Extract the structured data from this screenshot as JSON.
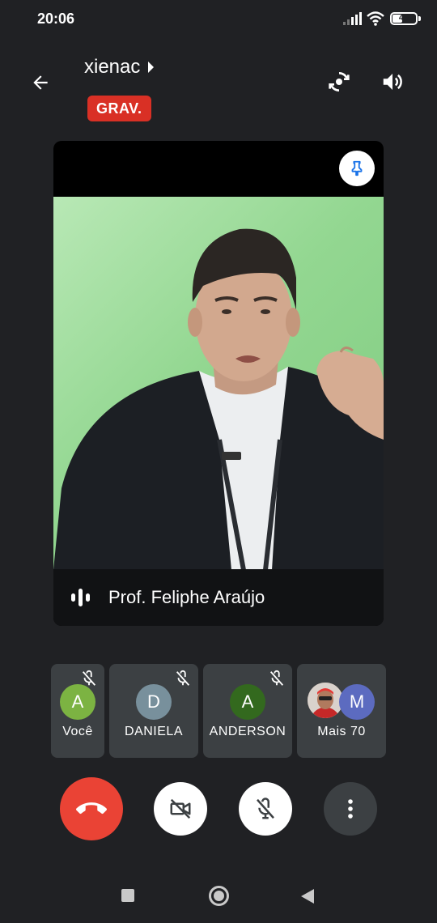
{
  "status_bar": {
    "time": "20:06",
    "battery_level": "43",
    "battery_fraction": 0.43
  },
  "header": {
    "meeting_title": "xienac",
    "recording_badge": "GRAV.",
    "icons": {
      "back": "arrow-left",
      "switch_camera": "camera-switch",
      "audio_output": "volume-up"
    }
  },
  "main_video": {
    "speaker_name": "Prof. Feliphe Araújo",
    "background_color": "#93d791",
    "icons": {
      "pin": "pin",
      "speaking": "audio-levels"
    }
  },
  "participants": [
    {
      "name": "Você",
      "initial": "A",
      "avatar_color": "#7cb342",
      "muted": true
    },
    {
      "name": "DANIELA",
      "initial": "D",
      "avatar_color": "#78909c",
      "muted": true
    },
    {
      "name": "ANDERSON",
      "initial": "A",
      "avatar_color": "#33691e",
      "muted": true
    },
    {
      "name": "Mais 70",
      "initial": "M",
      "avatar_color": "#5c6bc0",
      "muted": false
    }
  ],
  "controls": {
    "end_call_color": "#ea4335",
    "icons": [
      "phone-hangup",
      "camera-off",
      "mic-off",
      "more-vert"
    ]
  },
  "colors": {
    "background": "#202124",
    "tile": "#3c4043",
    "recording": "#d93025",
    "pin_accent": "#1a73e8"
  }
}
